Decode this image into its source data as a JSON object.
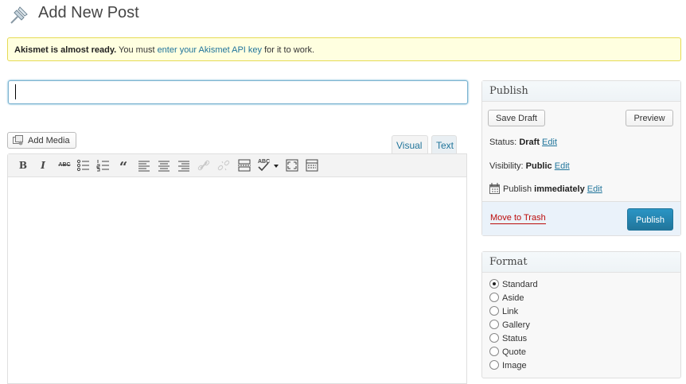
{
  "header": {
    "title": "Add New Post",
    "icon": "pushpin-icon"
  },
  "notice": {
    "strong": "Akismet is almost ready.",
    "text_before": " You must ",
    "link": "enter your Akismet API key",
    "text_after": " for it to work."
  },
  "title_input": {
    "value": "",
    "placeholder": ""
  },
  "media": {
    "add_media_label": "Add Media"
  },
  "editor": {
    "tabs": [
      "Visual",
      "Text"
    ],
    "toolbar": [
      "bold-icon",
      "italic-icon",
      "strikethrough-icon",
      "bullet-list-icon",
      "numbered-list-icon",
      "blockquote-icon",
      "align-left-icon",
      "align-center-icon",
      "align-right-icon",
      "link-icon",
      "unlink-icon",
      "more-tag-icon",
      "spellcheck-icon",
      "fullscreen-icon",
      "kitchen-sink-icon"
    ],
    "bold_label": "B",
    "italic_label": "I",
    "strike_label": "ABC",
    "quote_label": "“",
    "spell_label": "ABC"
  },
  "publish": {
    "title": "Publish",
    "save_draft": "Save Draft",
    "preview": "Preview",
    "status_label": "Status:",
    "status_value": "Draft",
    "visibility_label": "Visibility:",
    "visibility_value": "Public",
    "publish_label": "Publish",
    "publish_value": "immediately",
    "edit_label": "Edit",
    "move_to_trash": "Move to Trash",
    "publish_button": "Publish"
  },
  "format": {
    "title": "Format",
    "selected": "Standard",
    "options": [
      "Standard",
      "Aside",
      "Link",
      "Gallery",
      "Status",
      "Quote",
      "Image"
    ]
  },
  "colors": {
    "link": "#21759b",
    "primary_button": "#21759b",
    "trash": "#bc0b0b",
    "notice_bg": "#ffffe0",
    "notice_border": "#e6db55"
  }
}
